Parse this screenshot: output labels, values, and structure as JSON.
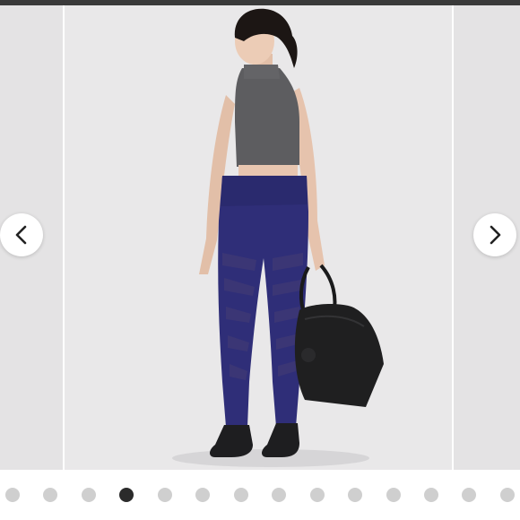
{
  "carousel": {
    "slide_count": 14,
    "active_index": 3,
    "active_slide": "product-photo-model-leggings",
    "prev_icon": "chevron-left-icon",
    "next_icon": "chevron-right-icon"
  },
  "colors": {
    "background": "#ffffff",
    "slide_background": "#e9e8e9",
    "dot_inactive": "#cfcfcf",
    "dot_active": "#2b2b2b",
    "leggings": "#2f2e78",
    "top": "#5d5d60",
    "bag": "#1f1f20"
  }
}
